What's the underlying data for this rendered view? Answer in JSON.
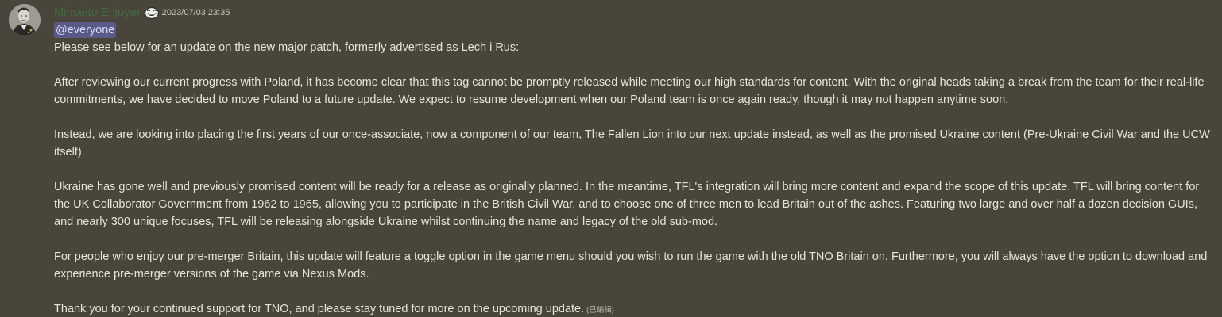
{
  "author": {
    "name": "Minseito Enjoyer",
    "role_icon": "trollface-icon",
    "timestamp": "2023/07/03 23:35"
  },
  "message": {
    "mention": "@everyone",
    "paragraphs": [
      "Please see below for an update on the new major patch, formerly advertised as Lech i Rus:",
      "After reviewing our current progress with Poland, it has become clear that this tag cannot be promptly released while meeting our high standards for content. With the original heads taking a break from the team for their real-life commitments, we have decided to move Poland to a future update. We expect to resume development when our Poland team is once again ready, though it may not happen anytime soon.",
      "Instead, we are looking into placing the first years of our once-associate, now a component of our team, The Fallen Lion into our next update instead, as well as the promised Ukraine content (Pre-Ukraine Civil War and the UCW itself).",
      "Ukraine has gone well and previously promised content will be ready for a release as originally planned. In the meantime, TFL's integration will bring more content and expand the scope of this update. TFL will bring content for the UK Collaborator Government from 1962 to 1965, allowing you to participate in the British Civil War, and to choose one of three men to lead Britain out of the ashes. Featuring two large and over half a dozen decision GUIs, and nearly 300 unique focuses, TFL will be releasing alongside Ukraine whilst continuing the name and legacy of the old sub-mod.",
      "For people who enjoy our pre-merger Britain, this update will feature a toggle option in the game menu should you wish to run the game with the old TNO Britain on. Furthermore, you will always have the option to download and experience pre-merger versions of the game via Nexus Mods.",
      "Thank you for your continued support for TNO, and please stay tuned for more on the upcoming update."
    ],
    "edited_label": "(已编辑)"
  },
  "colors": {
    "background": "#4a4538",
    "username": "#3f6e41",
    "text": "#e8e5d8",
    "mention_bg": "#5a5a8a",
    "timestamp": "#c9c5b6"
  }
}
